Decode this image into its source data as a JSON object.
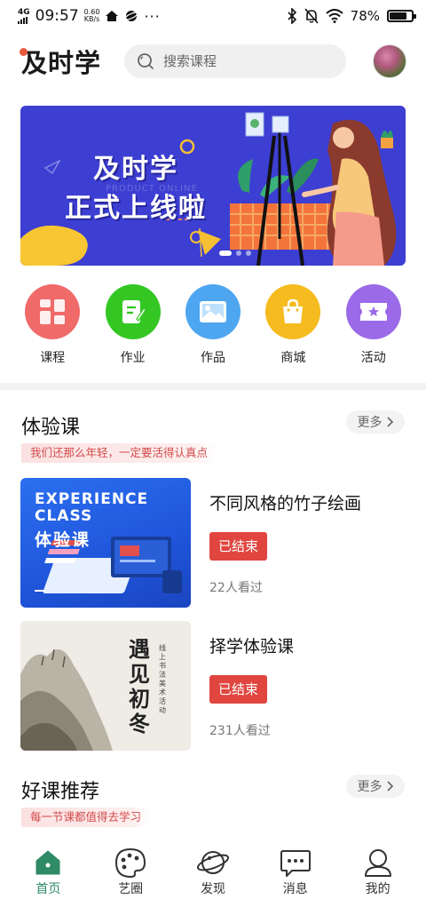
{
  "status_bar": {
    "network": "4G",
    "time": "09:57",
    "net_speed_value": "0.60",
    "net_speed_unit": "KB/s",
    "battery": "78%",
    "battery_level": 0.78
  },
  "header": {
    "logo": "及时学",
    "search_placeholder": "搜索课程"
  },
  "banner": {
    "line1": "及时学",
    "line2": "正式上线啦",
    "sub": "PRODUCT ONLINE",
    "slide_count": 3,
    "active_slide": 0
  },
  "quick_menu": [
    {
      "label": "课程",
      "icon": "grid-icon",
      "color": "#f06a6a"
    },
    {
      "label": "作业",
      "icon": "homework-icon",
      "color": "#34c724"
    },
    {
      "label": "作品",
      "icon": "image-icon",
      "color": "#4ea6f0"
    },
    {
      "label": "商城",
      "icon": "shopping-bag-icon",
      "color": "#f5bb1f"
    },
    {
      "label": "活动",
      "icon": "ticket-icon",
      "color": "#9b6ae8"
    }
  ],
  "trial_section": {
    "title": "体验课",
    "tagline": "我们还那么年轻，一定要活得认真点",
    "more": "更多",
    "courses": [
      {
        "title": "不同风格的竹子绘画",
        "status": "已结束",
        "views": "22人看过",
        "image_text_line1": "EXPERIENCE",
        "image_text_line2": "CLASS",
        "image_text_line3": "体验课"
      },
      {
        "title": "择学体验课",
        "status": "已结束",
        "views": "231人看过",
        "image_text_line1": "遇见初冬",
        "image_text_line2": "线上书法美术活动"
      }
    ]
  },
  "recommend_section": {
    "title": "好课推荐",
    "tagline": "每一节课都值得去学习",
    "more": "更多"
  },
  "bottom_nav": [
    {
      "label": "首页",
      "icon": "home-icon",
      "active": true
    },
    {
      "label": "艺圈",
      "icon": "palette-icon",
      "active": false
    },
    {
      "label": "发现",
      "icon": "planet-icon",
      "active": false
    },
    {
      "label": "消息",
      "icon": "message-icon",
      "active": false
    },
    {
      "label": "我的",
      "icon": "user-icon",
      "active": false
    }
  ],
  "colors": {
    "accent_green": "#2f8a66",
    "status_red": "#e0463f",
    "banner_blue": "#3d3ed2",
    "tag_red": "#d44b4b"
  }
}
